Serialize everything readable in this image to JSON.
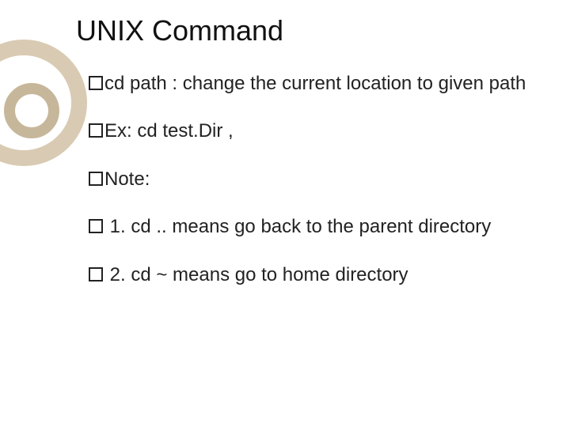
{
  "title": "UNIX Command",
  "bullets": {
    "b1a": "cd",
    "b1b": " path : change the current location to given path",
    "b2a": "Ex:",
    "b2b": " cd test.Dir ,",
    "b3": "Note:",
    "b4a": " 1. cd",
    "b4b": " .. means go back to the parent directory",
    "b5a": " 2.",
    "b5b": " cd ~ means go to home directory"
  }
}
